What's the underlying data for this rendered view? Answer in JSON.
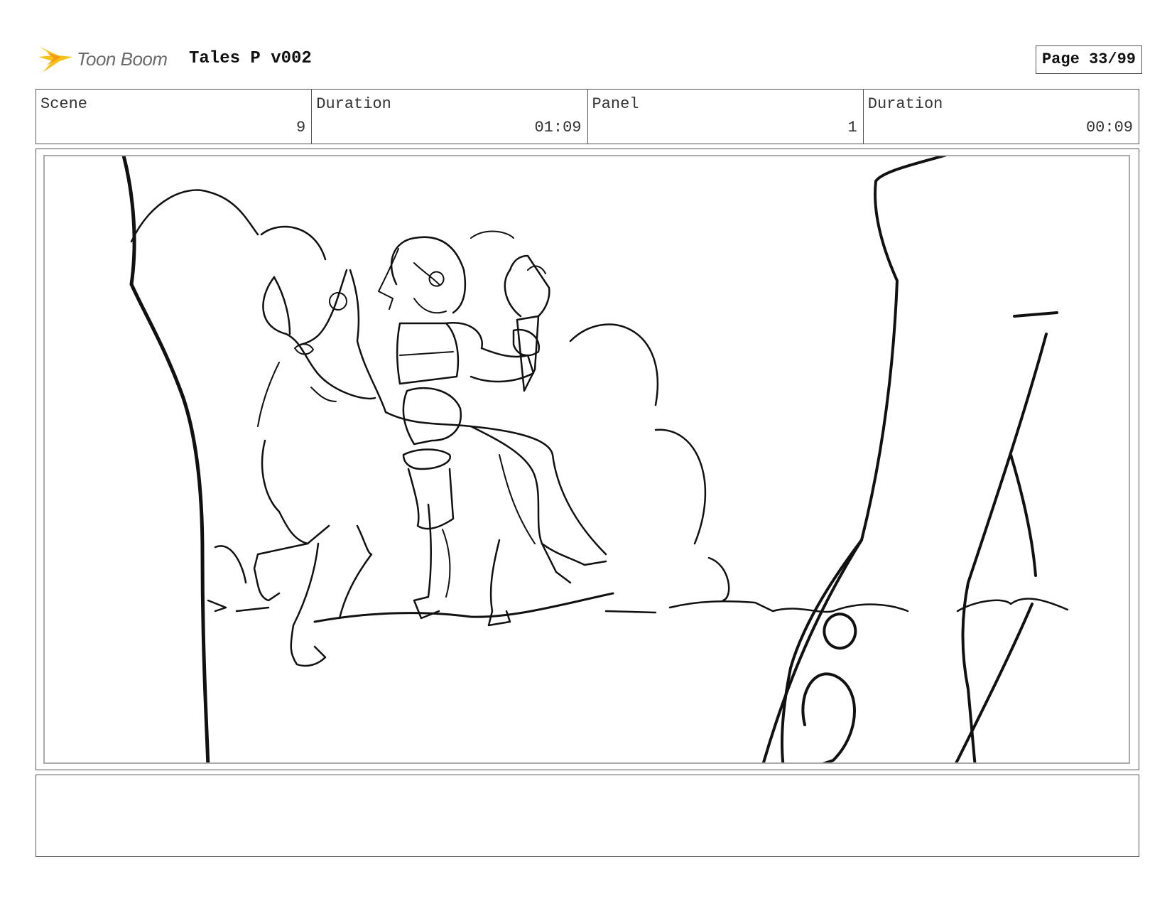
{
  "header": {
    "logo_text": "Toon Boom",
    "title": "Tales P v002",
    "page_label": "Page 33/99"
  },
  "info": {
    "scene_label": "Scene",
    "scene_value": "9",
    "scene_duration_label": "Duration",
    "scene_duration_value": "01:09",
    "panel_label": "Panel",
    "panel_value": "1",
    "panel_duration_label": "Duration",
    "panel_duration_value": "00:09"
  },
  "colors": {
    "logo_star": "#f6c21a",
    "ink": "#111111",
    "frame": "#555555"
  },
  "icons": {
    "logo": "toon-boom-star-logo"
  }
}
